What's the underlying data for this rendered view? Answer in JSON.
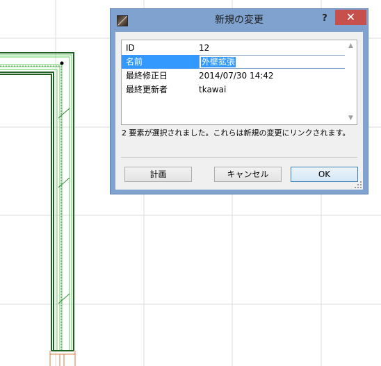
{
  "dialog": {
    "title": "新規の変更",
    "help_label": "?",
    "close_label": "✕",
    "rows": [
      {
        "key": "ID",
        "value": "12"
      },
      {
        "key": "名前",
        "value": "外壁拡張"
      },
      {
        "key": "最終修正日",
        "value": "2014/07/30 14:42"
      },
      {
        "key": "最終更新者",
        "value": "tkawai"
      }
    ],
    "message": "2 要素が選択されました。これらは新規の変更にリンクされます。",
    "buttons": {
      "plan": "計画",
      "cancel": "キャンセル",
      "ok": "OK"
    }
  },
  "icons": {
    "app": "archicad-app-icon",
    "scroll_up": "chevron-up-icon",
    "scroll_down": "chevron-down-icon",
    "resize": "resize-grip-icon"
  },
  "colors": {
    "selection": "#3399ff",
    "close_button": "#c7504c",
    "wall_outline": "#1f5f1f",
    "wall_fill": "#5fcf5f",
    "grid_line": "#dddddd"
  }
}
